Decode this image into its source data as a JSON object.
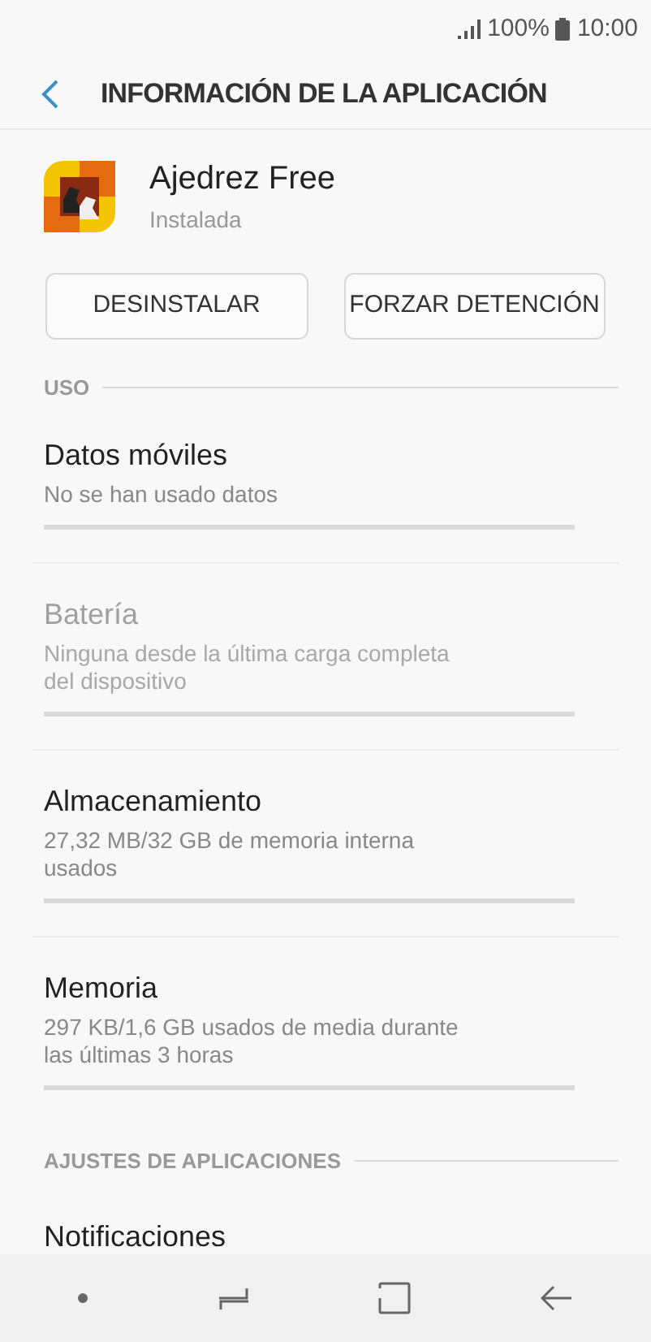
{
  "status_bar": {
    "battery": "100%",
    "time": "10:00"
  },
  "header": {
    "title": "INFORMACIÓN DE LA APLICACIÓN"
  },
  "app": {
    "name": "Ajedrez Free",
    "status": "Instalada"
  },
  "buttons": [
    "DESINSTALAR",
    "FORZAR DETENCIÓN"
  ],
  "usage": {
    "heading": "USO",
    "items": [
      {
        "title": "Datos móviles",
        "subtitle": "No se han usado datos",
        "disabled": false
      },
      {
        "title": "Batería",
        "subtitle": "Ninguna desde la última carga completa del dispositivo",
        "disabled": true
      },
      {
        "title": "Almacenamiento",
        "subtitle": "27,32 MB/32 GB de memoria interna usados",
        "disabled": false
      },
      {
        "title": "Memoria",
        "subtitle": "297 KB/1,6 GB usados de media durante las últimas 3 horas",
        "disabled": false
      }
    ]
  },
  "app_settings": {
    "heading": "AJUSTES DE APLICACIONES",
    "items": [
      {
        "title": "Notificaciones"
      }
    ]
  }
}
